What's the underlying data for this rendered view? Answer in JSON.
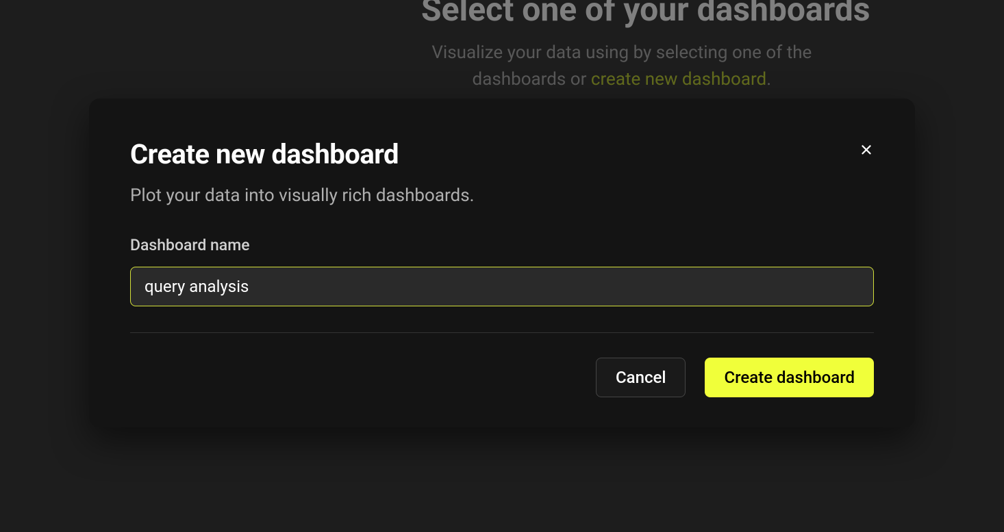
{
  "background": {
    "heading": "Select one of your dashboards",
    "subtext_prefix": "Visualize your data using by selecting one of the",
    "subtext_middle": "dashboards or ",
    "subtext_link": "create new dashboard",
    "subtext_suffix": "."
  },
  "modal": {
    "title": "Create new dashboard",
    "subtitle": "Plot your data into visually rich dashboards.",
    "form": {
      "label": "Dashboard name",
      "value": "query analysis"
    },
    "buttons": {
      "cancel": "Cancel",
      "submit": "Create dashboard"
    }
  }
}
